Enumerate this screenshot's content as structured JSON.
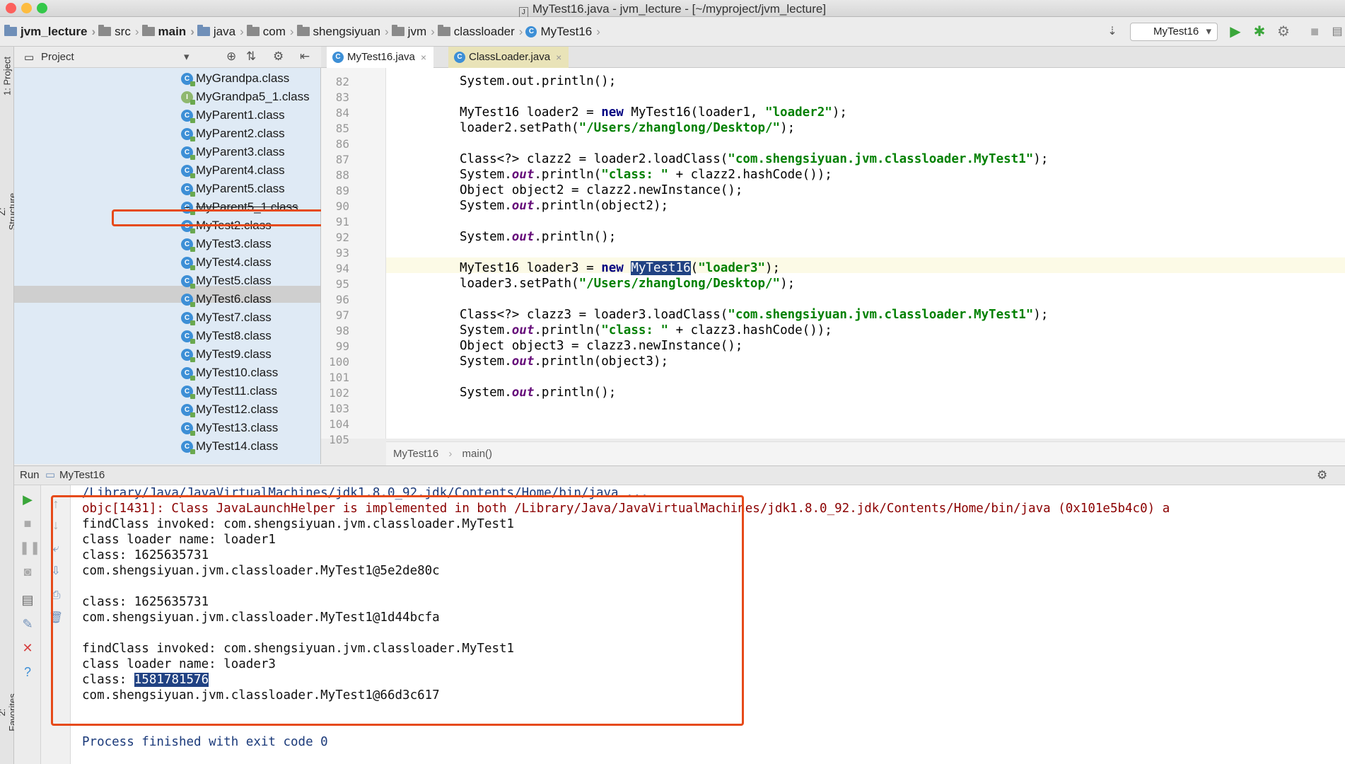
{
  "window": {
    "title": "MyTest16.java - jvm_lecture - [~/myproject/jvm_lecture]",
    "traffic_colors": [
      "#fc605c",
      "#fdbc40",
      "#34c84a"
    ]
  },
  "breadcrumb": [
    "jvm_lecture",
    "src",
    "main",
    "java",
    "com",
    "shengsiyuan",
    "jvm",
    "classloader",
    "MyTest16"
  ],
  "toolbar": {
    "run_config": "MyTest16"
  },
  "left_strip": {
    "project_tab": "1: Project",
    "structure_tab": "Z: Structure",
    "favorites_tab": "2: Favorites"
  },
  "project_panel": {
    "title": "Project",
    "items": [
      "MyGrandpa.class",
      "MyGrandpa5_1.class",
      "MyParent1.class",
      "MyParent2.class",
      "MyParent3.class",
      "MyParent4.class",
      "MyParent5.class",
      "MyParent5_1.class",
      "MyTest2.class",
      "MyTest3.class",
      "MyTest4.class",
      "MyTest5.class",
      "MyTest6.class",
      "MyTest7.class",
      "MyTest8.class",
      "MyTest9.class",
      "MyTest10.class",
      "MyTest11.class",
      "MyTest12.class",
      "MyTest13.class",
      "MyTest14.class"
    ]
  },
  "editor": {
    "tabs": [
      "MyTest16.java",
      "ClassLoader.java"
    ],
    "line_numbers": [
      "82",
      "83",
      "84",
      "85",
      "86",
      "87",
      "88",
      "89",
      "90",
      "91",
      "92",
      "93",
      "94",
      "95",
      "96",
      "97",
      "98",
      "99",
      "100",
      "101",
      "102",
      "103",
      "104",
      "105"
    ],
    "lines": {
      "l82": "System.out.println();",
      "l84_a": "MyTest16 loader2 = ",
      "l84_kw": "new",
      "l84_b": " MyTest16(loader1, ",
      "l84_str": "\"loader2\"",
      "l84_c": ");",
      "l85_a": "loader2.setPath(",
      "l85_str": "\"/Users/zhanglong/Desktop/\"",
      "l85_b": ");",
      "l87_a": "Class<?> clazz2 = loader2.loadClass(",
      "l87_str": "\"com.shengsiyuan.jvm.classloader.MyTest1\"",
      "l87_b": ");",
      "l88_a": "System.",
      "l88_fd": "out",
      "l88_b": ".println(",
      "l88_str": "\"class: \"",
      "l88_c": " + clazz2.hashCode());",
      "l89": "Object object2 = clazz2.newInstance();",
      "l90_a": "System.",
      "l90_fd": "out",
      "l90_b": ".println(object2);",
      "l92_a": "System.",
      "l92_fd": "out",
      "l92_b": ".println();",
      "l94_a": "MyTest16 loader3 = ",
      "l94_kw": "new",
      "l94_sel": "MyTest16",
      "l94_b": "(",
      "l94_str": "\"loader3\"",
      "l94_c": ");",
      "l95_a": "loader3.setPath(",
      "l95_str": "\"/Users/zhanglong/Desktop/\"",
      "l95_b": ");",
      "l97_a": "Class<?> clazz3 = loader3.loadClass(",
      "l97_str": "\"com.shengsiyuan.jvm.classloader.MyTest1\"",
      "l97_b": ");",
      "l98_a": "System.",
      "l98_fd": "out",
      "l98_b": ".println(",
      "l98_str": "\"class: \"",
      "l98_c": " + clazz3.hashCode());",
      "l99": "Object object3 = clazz3.newInstance();",
      "l100_a": "System.",
      "l100_fd": "out",
      "l100_b": ".println(object3);",
      "l102_a": "System.",
      "l102_fd": "out",
      "l102_b": ".println();"
    },
    "breadcrumb": [
      "MyTest16",
      "main()"
    ]
  },
  "run_panel": {
    "label": "Run",
    "config": "MyTest16",
    "console": {
      "cmd": "/Library/Java/JavaVirtualMachines/jdk1.8.0_92.jdk/Contents/Home/bin/java ...",
      "objc": "objc[1431]: Class JavaLaunchHelper is implemented in both /Library/Java/JavaVirtualMachines/jdk1.8.0_92.jdk/Contents/Home/bin/java (0x101e5b4c0) a",
      "l1": "findClass invoked: com.shengsiyuan.jvm.classloader.MyTest1",
      "l2": "class loader name: loader1",
      "l3": "class: 1625635731",
      "l4": "com.shengsiyuan.jvm.classloader.MyTest1@5e2de80c",
      "l6": "class: 1625635731",
      "l7": "com.shengsiyuan.jvm.classloader.MyTest1@1d44bcfa",
      "l9": "findClass invoked: com.shengsiyuan.jvm.classloader.MyTest1",
      "l10": "class loader name: loader3",
      "l11_a": "class: ",
      "l11_sel": "1581781576",
      "l12": "com.shengsiyuan.jvm.classloader.MyTest1@66d3c617",
      "exit": "Process finished with exit code 0"
    }
  }
}
